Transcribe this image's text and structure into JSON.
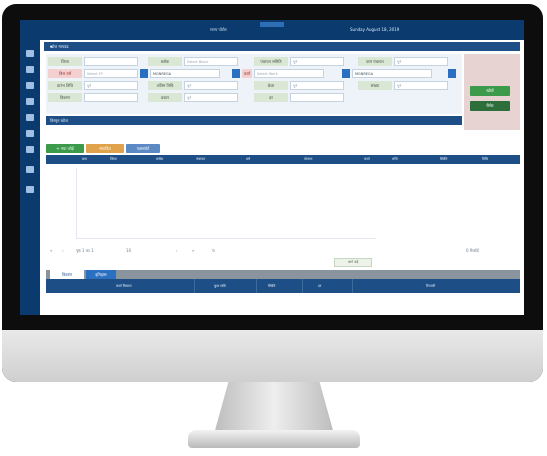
{
  "app": {
    "window_title": "राज्य पोर्टल",
    "user_info": "Sunday August 18, 2019",
    "panel_title": "खोज मापदंड"
  },
  "form": {
    "fields": [
      {
        "label": "जिला",
        "value": "",
        "placeholder": ""
      },
      {
        "label": "ब्लॉक",
        "value": "",
        "placeholder": "Select Block"
      },
      {
        "label": "पंचायत समिति",
        "value": "",
        "placeholder": "चुनें"
      },
      {
        "label": "ग्राम पंचायत",
        "value": "",
        "placeholder": "चुनें"
      },
      {
        "label": "वित्त वर्ष",
        "value": "",
        "placeholder": "Select FY",
        "pink": true
      },
      {
        "label": "योजना",
        "value": "MGNREGA",
        "placeholder": ""
      },
      {
        "label": "कार्य",
        "value": "",
        "placeholder": "Select Work",
        "pink": true
      },
      {
        "label": "स्थिति",
        "value": "MGNREGA",
        "placeholder": ""
      },
      {
        "label": "प्रारंभ तिथि",
        "value": "",
        "placeholder": "चुनें"
      },
      {
        "label": "अंतिम तिथि",
        "value": "",
        "placeholder": "चुनें"
      },
      {
        "label": "क्रेता",
        "value": "",
        "placeholder": "चुनें"
      },
      {
        "label": "संख्या",
        "value": "",
        "placeholder": "चुनें"
      },
      {
        "label": "विवरण",
        "value": "",
        "placeholder": ""
      },
      {
        "label": "प्रकार",
        "value": "",
        "placeholder": "चुनें"
      },
      {
        "label": "दर",
        "value": "",
        "placeholder": ""
      }
    ],
    "strip_label": "विस्तृत खोज",
    "search_button": "खोजें",
    "reset_button": "रीसेट"
  },
  "actions": {
    "add": "+ नया जोड़ें",
    "edit": "संपादित",
    "export": "एक्सपोर्ट"
  },
  "table": {
    "headers": [
      "क्रम",
      "जिला",
      "ब्लॉक",
      "पंचायत",
      "वर्ष",
      "योजना",
      "कार्य",
      "राशि",
      "स्थिति",
      "तिथि"
    ],
    "pager_text": "पृष्ठ 1 का 1",
    "page_size": "10",
    "records_text": "0 रिकॉर्ड",
    "page_button": "आगे बढ़ें"
  },
  "details": {
    "tabs": [
      "विवरण",
      "इतिहास"
    ],
    "headers": [
      "कार्य विवरण",
      "कुल राशि",
      "स्थिति",
      "दर",
      "टिप्पणी"
    ]
  },
  "colors": {
    "brand": "#0b3b6e",
    "header": "#1d4f86",
    "accent_green": "#3c9a4b",
    "label_green": "#dbe7d5",
    "label_pink": "#f3d0cf"
  }
}
